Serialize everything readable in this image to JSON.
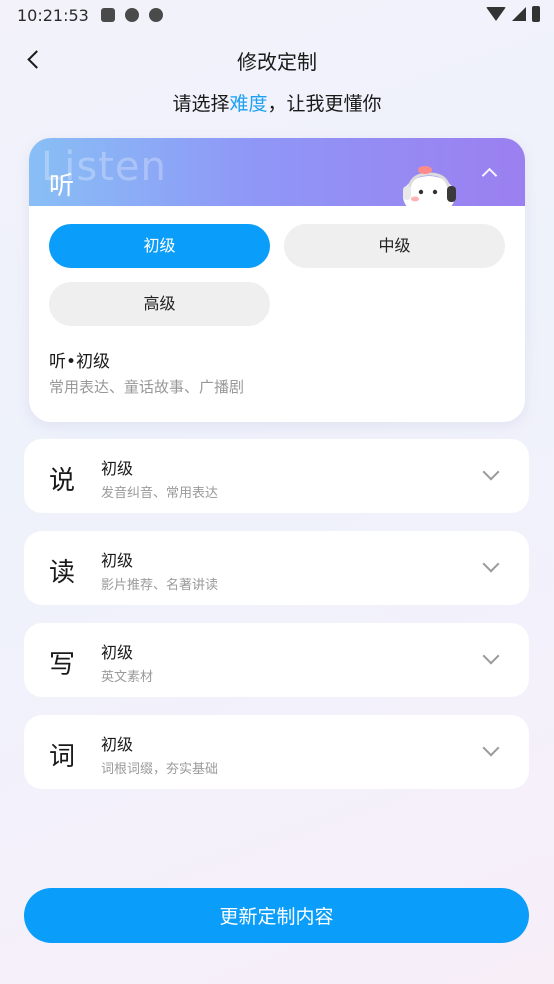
{
  "status_bar": {
    "time": "10:21:53"
  },
  "header": {
    "title": "修改定制"
  },
  "subtitle": {
    "prefix": "请选择",
    "highlight": "难度",
    "suffix": "，让我更懂你"
  },
  "listen": {
    "watermark": "Listen",
    "char": "听",
    "levels": [
      "初级",
      "中级",
      "高级"
    ],
    "selected_title": "听•初级",
    "selected_desc": "常用表达、童话故事、广播剧"
  },
  "skills": [
    {
      "char": "说",
      "level": "初级",
      "desc": "发音纠音、常用表达"
    },
    {
      "char": "读",
      "level": "初级",
      "desc": "影片推荐、名著讲读"
    },
    {
      "char": "写",
      "level": "初级",
      "desc": "英文素材"
    },
    {
      "char": "词",
      "level": "初级",
      "desc": "词根词缀，夯实基础"
    }
  ],
  "actions": {
    "update_label": "更新定制内容"
  },
  "colors": {
    "accent": "#0a9dfa",
    "highlight": "#1ba0f2",
    "header_gradient": [
      "#88bff5",
      "#9b7ff0"
    ]
  }
}
